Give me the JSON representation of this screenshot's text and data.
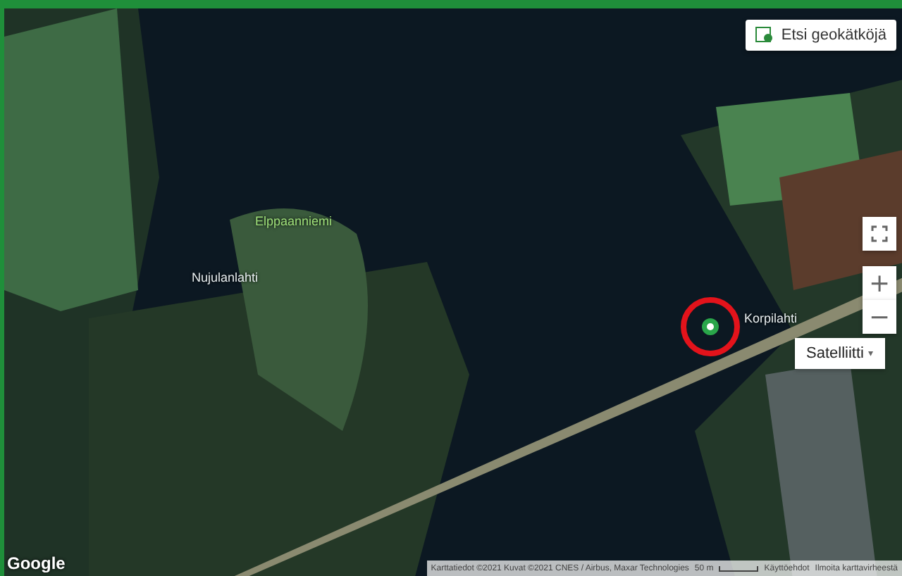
{
  "search_button": {
    "label": "Etsi geokätköjä"
  },
  "map_type": {
    "label": "Satelliitti",
    "caret": "▾"
  },
  "zoom": {
    "in": "+",
    "out": "−"
  },
  "place_labels": [
    {
      "text": "Nujulanlahti",
      "kind": "place"
    },
    {
      "text": "Elppaanniemi",
      "kind": "park"
    },
    {
      "text": "Korpilahti",
      "kind": "place"
    }
  ],
  "marker": {
    "highlighted": true
  },
  "logo": "Google",
  "attribution": {
    "data": "Karttatiedot ©2021 Kuvat ©2021 CNES / Airbus, Maxar Technologies",
    "scale": "50 m",
    "terms": "Käyttöehdot",
    "report": "Ilmoita karttavirheestä"
  }
}
